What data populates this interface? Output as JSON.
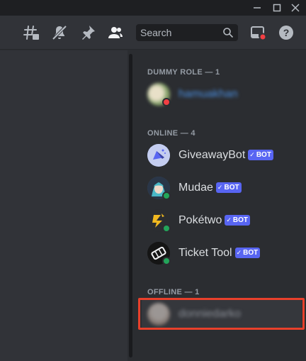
{
  "window": {
    "minimize_icon": "minimize-icon",
    "maximize_icon": "maximize-icon",
    "close_icon": "close-icon"
  },
  "header": {
    "icons": [
      "threads-icon",
      "mute-icon",
      "pin-icon",
      "members-icon"
    ],
    "search": {
      "placeholder": "Search"
    },
    "inbox_icon": "inbox-icon",
    "help_icon": "help-icon"
  },
  "members": {
    "sections": [
      {
        "title": "DUMMY ROLE — 1"
      },
      {
        "title": "ONLINE — 4"
      },
      {
        "title": "OFFLINE — 1"
      }
    ],
    "dummy_role": [
      {
        "name": "hamuakhan",
        "status": "dnd"
      }
    ],
    "online": [
      {
        "name": "GiveawayBot",
        "bot_label": "BOT",
        "status": "online"
      },
      {
        "name": "Mudae",
        "bot_label": "BOT",
        "status": "online"
      },
      {
        "name": "Pokétwo",
        "bot_label": "BOT",
        "status": "online"
      },
      {
        "name": "Ticket Tool",
        "bot_label": "BOT",
        "status": "online"
      }
    ],
    "offline": [
      {
        "name": "donniedarko",
        "status": "offline"
      }
    ]
  },
  "colors": {
    "accent": "#5865f2",
    "online": "#23a55a",
    "dnd": "#f23f43",
    "highlight": "#e8402b"
  }
}
